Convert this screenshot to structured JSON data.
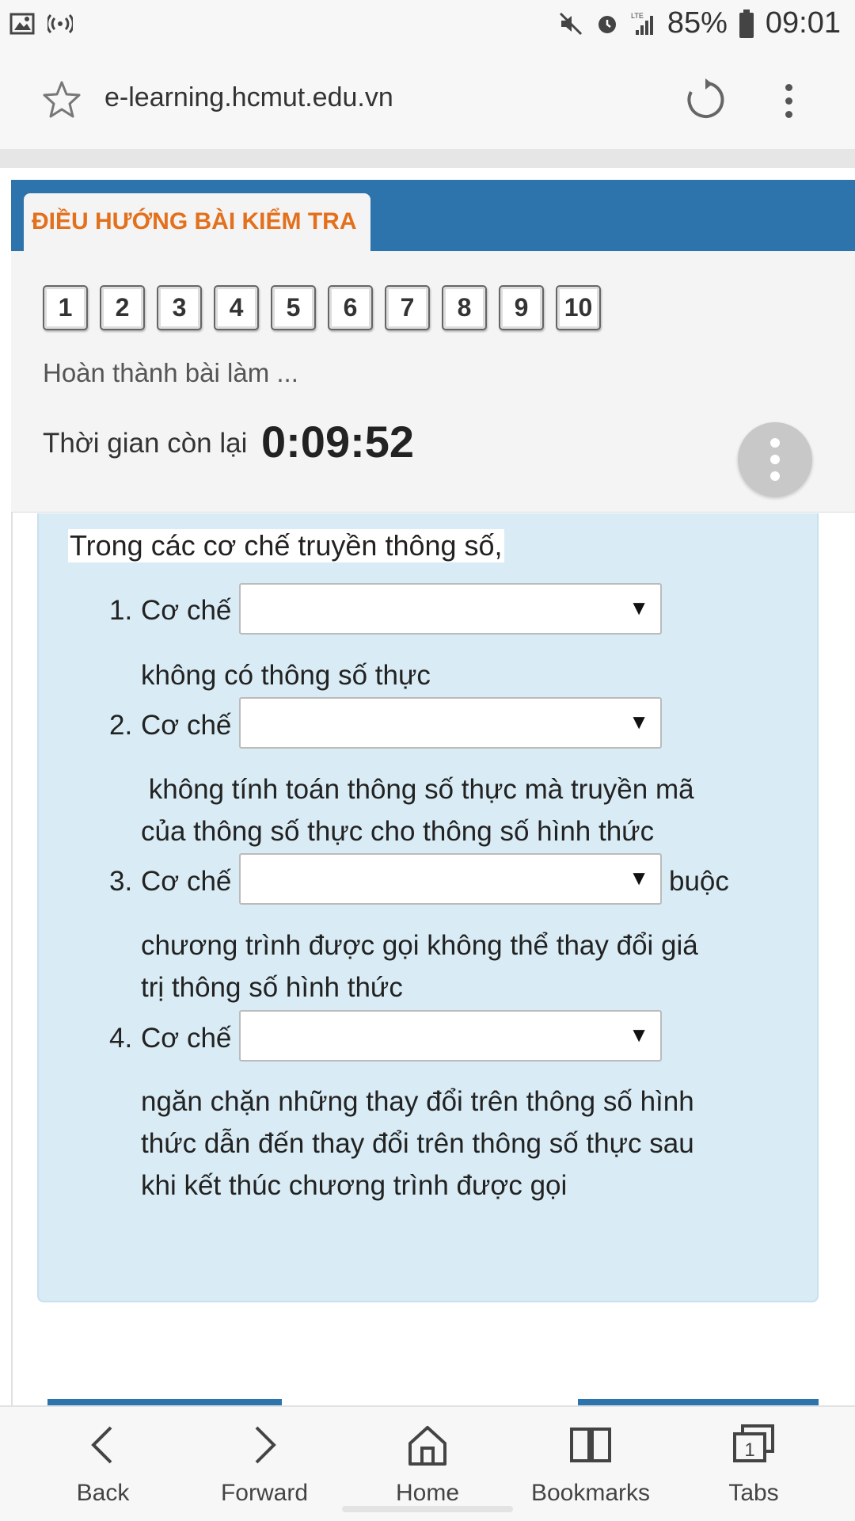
{
  "status_bar": {
    "battery": "85%",
    "time": "09:01",
    "network": "LTE"
  },
  "browser": {
    "url": "e-learning.hcmut.edu.vn"
  },
  "quiz_nav": {
    "header": "ĐIỀU HƯỚNG BÀI KIỂM TRA",
    "questions": [
      "1",
      "2",
      "3",
      "4",
      "5",
      "6",
      "7",
      "8",
      "9",
      "10"
    ],
    "finish_link": "Hoàn thành bài làm ...",
    "timer_label": "Thời gian còn lại",
    "timer_value": "0:09:52"
  },
  "question": {
    "intro": "Trong các cơ chế truyền thông số,",
    "items": [
      {
        "num": "1.",
        "prefix": "Cơ chế",
        "inline_after": "",
        "text_lines": [
          "không có thông số thực"
        ]
      },
      {
        "num": "2.",
        "prefix": "Cơ chế",
        "inline_after": "",
        "text_lines": [
          " không tính toán thông số thực mà truyền mã",
          "của thông số thực cho thông số hình thức"
        ]
      },
      {
        "num": "3.",
        "prefix": "Cơ chế",
        "inline_after": "buộc",
        "text_lines": [
          "chương trình được gọi không thể thay đổi giá",
          "trị thông số hình thức"
        ]
      },
      {
        "num": "4.",
        "prefix": "Cơ chế",
        "inline_after": "",
        "text_lines": [
          "ngăn chặn những thay đổi trên thông số hình",
          "thức dẫn đến thay đổi trên thông số thực sau",
          "khi kết thúc chương trình được gọi"
        ]
      }
    ],
    "select_value": "",
    "select_arrow": "▼"
  },
  "bottom_nav": {
    "back": "Back",
    "forward": "Forward",
    "home": "Home",
    "bookmarks": "Bookmarks",
    "tabs": "Tabs",
    "tabs_count": "1"
  },
  "colors": {
    "header_blue": "#2c74ab",
    "tab_orange": "#e3701c",
    "question_bg": "#d9ecf5"
  }
}
